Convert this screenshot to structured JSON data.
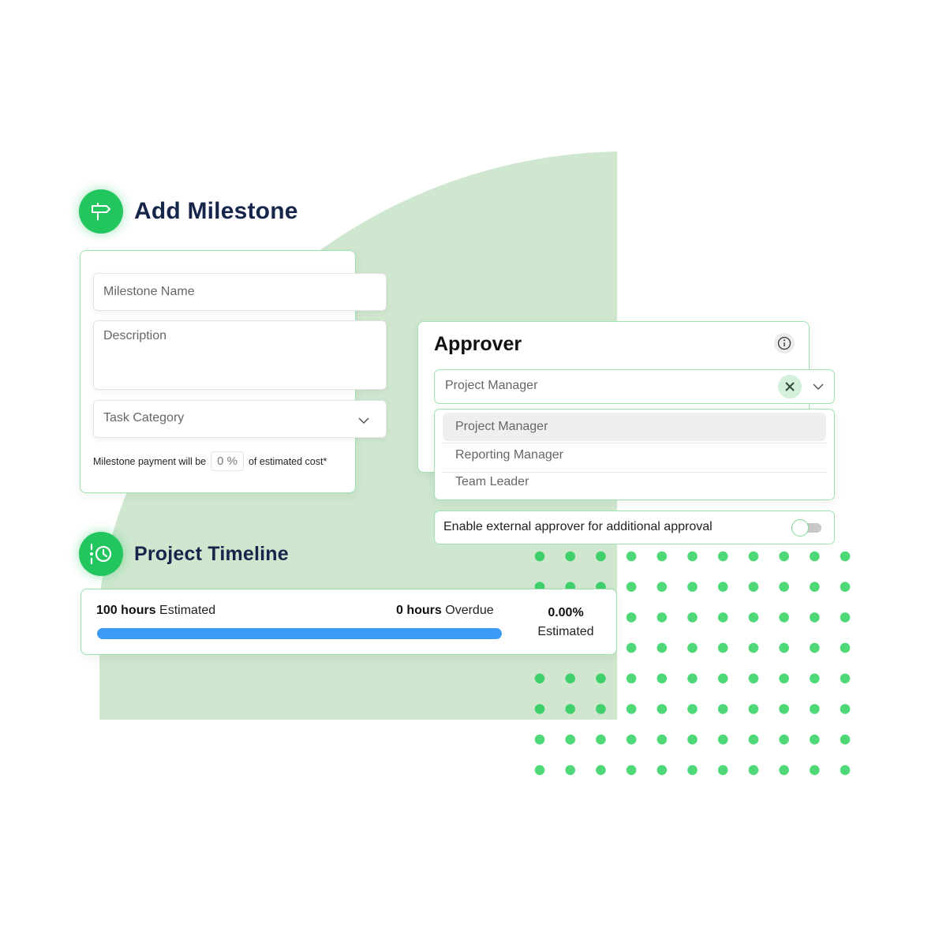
{
  "colors": {
    "accent": "#22c55e",
    "background_shape": "#cfe7cf",
    "dot": "#4fd877",
    "card_border": "#9ee3b0",
    "progress_fill": "#3b9bf5",
    "title_text": "#16254a"
  },
  "milestone": {
    "icon": "signpost-icon",
    "title": "Add Milestone",
    "name_placeholder": "Milestone Name",
    "description_placeholder": "Description",
    "category_placeholder": "Task Category",
    "payment_prefix": "Milestone payment will be",
    "payment_value": "0 %",
    "payment_suffix": "of estimated cost*"
  },
  "approver": {
    "title": "Approver",
    "info_icon": "info-icon",
    "selected": "Project Manager",
    "options": [
      {
        "label": "Project Manager",
        "selected": true
      },
      {
        "label": "Reporting Manager",
        "selected": false
      },
      {
        "label": "Team Leader",
        "selected": false
      }
    ],
    "external_toggle_label": "Enable external approver for additional approval",
    "external_toggle_on": false
  },
  "timeline": {
    "icon": "timeline-clock-icon",
    "title": "Project Timeline",
    "estimated_value": "100 hours",
    "estimated_label": "Estimated",
    "overdue_value": "0 hours",
    "overdue_label": "Overdue",
    "percent_value": "0.00%",
    "percent_label": "Estimated",
    "progress_fraction": 1.0
  }
}
